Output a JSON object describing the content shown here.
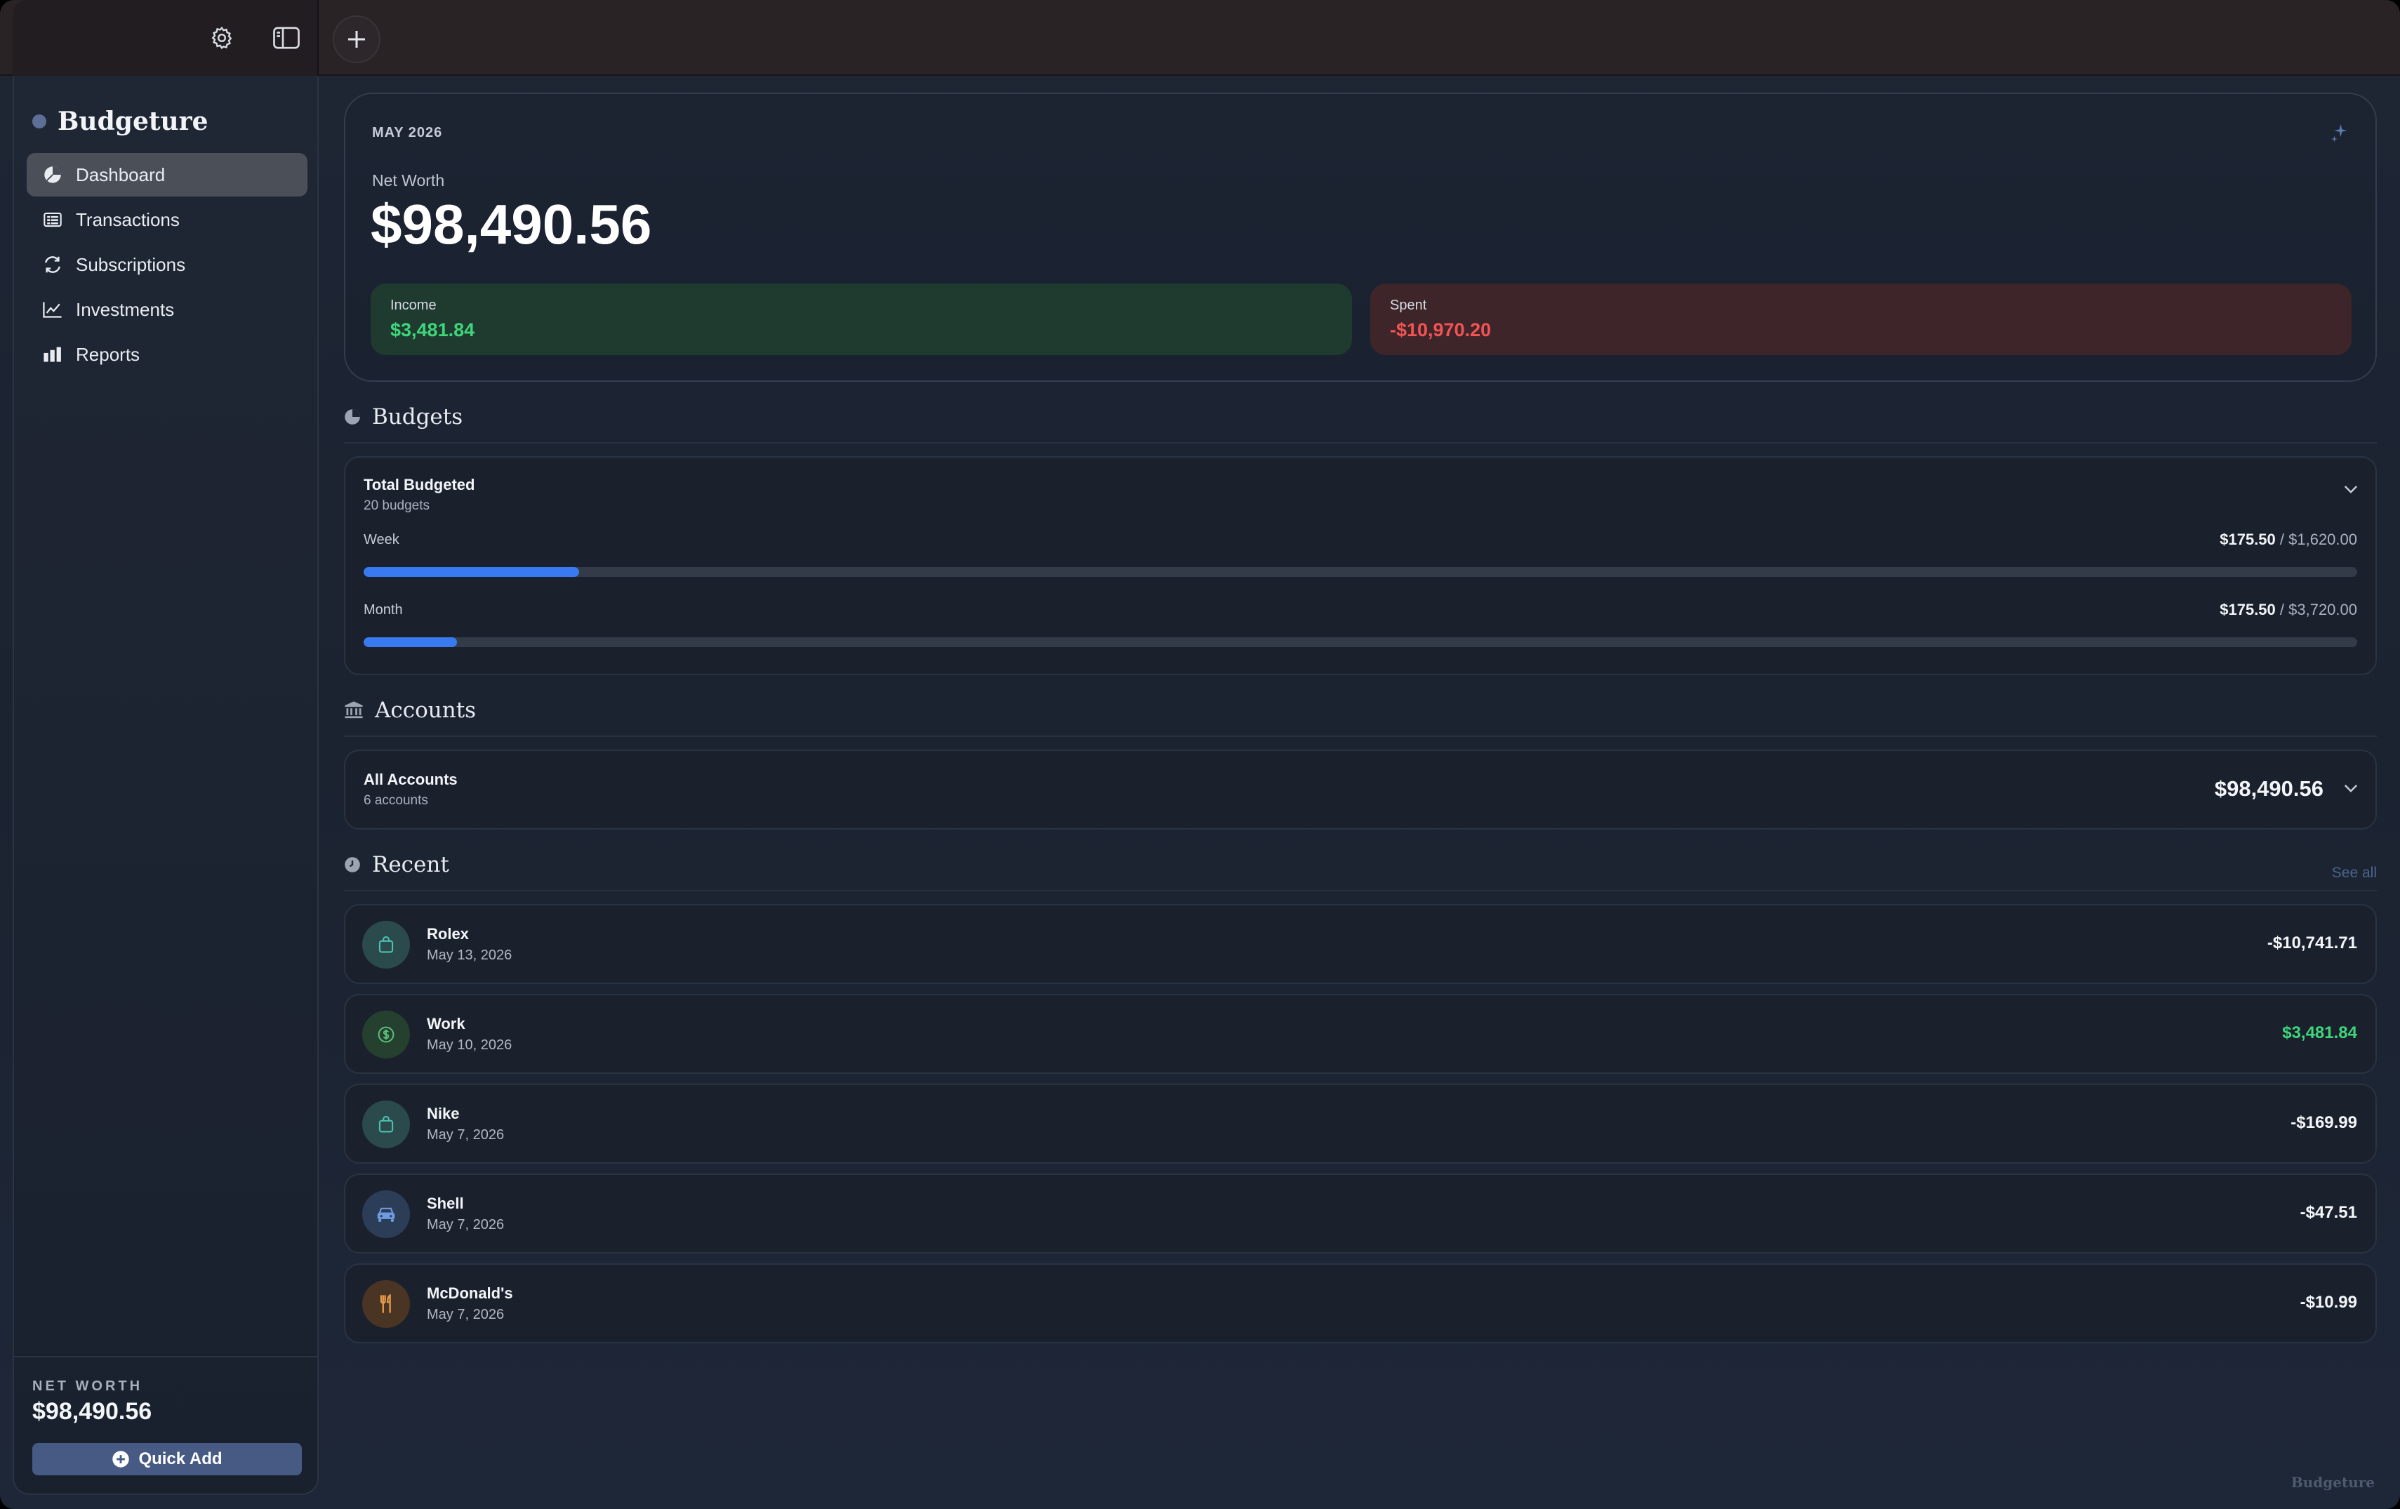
{
  "app": {
    "name": "Budgeture",
    "footer_brand": "Budgeture"
  },
  "toolbar": {
    "settings_icon": "gear-icon",
    "sidebar_icon": "sidebar-toggle-icon",
    "add_icon": "plus-icon"
  },
  "sidebar": {
    "items": [
      {
        "label": "Dashboard",
        "icon": "pie-chart-icon",
        "active": true
      },
      {
        "label": "Transactions",
        "icon": "list-icon",
        "active": false
      },
      {
        "label": "Subscriptions",
        "icon": "refresh-icon",
        "active": false
      },
      {
        "label": "Investments",
        "icon": "line-chart-icon",
        "active": false
      },
      {
        "label": "Reports",
        "icon": "bar-chart-icon",
        "active": false
      }
    ],
    "net_worth_label": "NET WORTH",
    "net_worth_value": "$98,490.56",
    "quick_add_label": "Quick Add"
  },
  "hero": {
    "month": "MAY 2026",
    "net_worth_label": "Net Worth",
    "net_worth_value": "$98,490.56",
    "income_label": "Income",
    "income_value": "$3,481.84",
    "spent_label": "Spent",
    "spent_value": "-$10,970.20"
  },
  "budgets": {
    "section_title": "Budgets",
    "title": "Total Budgeted",
    "subtitle": "20 budgets",
    "rows": [
      {
        "label": "Week",
        "spent": "$175.50",
        "separator": " / ",
        "total": "$1,620.00",
        "progress": 0.108
      },
      {
        "label": "Month",
        "spent": "$175.50",
        "separator": " / ",
        "total": "$3,720.00",
        "progress": 0.047
      }
    ]
  },
  "accounts": {
    "section_title": "Accounts",
    "title": "All Accounts",
    "subtitle": "6 accounts",
    "total": "$98,490.56"
  },
  "recent": {
    "section_title": "Recent",
    "see_all": "See all",
    "items": [
      {
        "name": "Rolex",
        "date": "May 13, 2026",
        "amount": "-$10,741.71",
        "icon": "shopping-bag-icon",
        "color": "#2a4a4c",
        "positive": false
      },
      {
        "name": "Work",
        "date": "May 10, 2026",
        "amount": "$3,481.84",
        "icon": "dollar-circle-icon",
        "color": "#26402f",
        "positive": true
      },
      {
        "name": "Nike",
        "date": "May 7, 2026",
        "amount": "-$169.99",
        "icon": "shopping-bag-icon",
        "color": "#2a4a4c",
        "positive": false
      },
      {
        "name": "Shell",
        "date": "May 7, 2026",
        "amount": "-$47.51",
        "icon": "car-icon",
        "color": "#2c3d57",
        "positive": false
      },
      {
        "name": "McDonald's",
        "date": "May 7, 2026",
        "amount": "-$10.99",
        "icon": "fork-knife-icon",
        "color": "#4a3424",
        "positive": false
      }
    ]
  }
}
